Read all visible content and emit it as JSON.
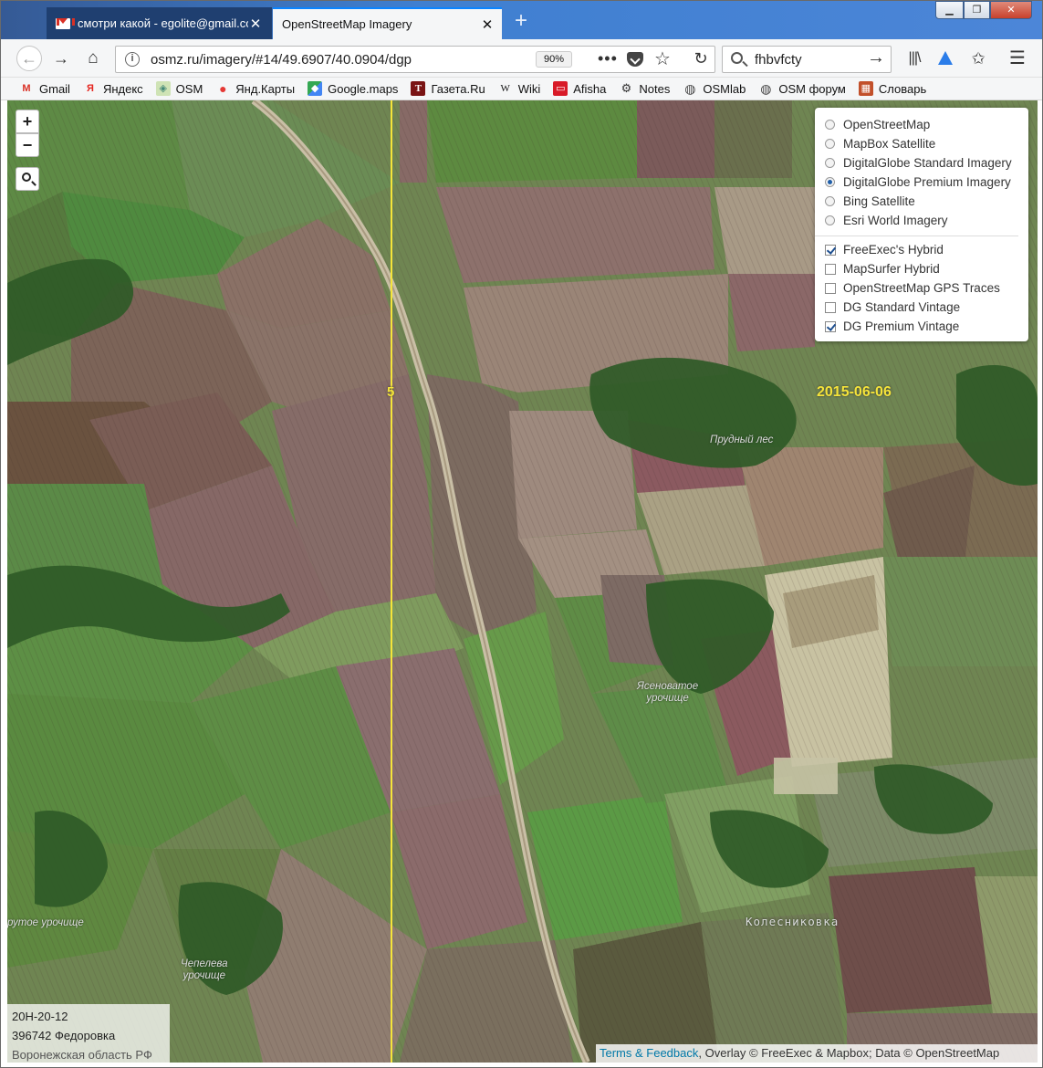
{
  "tabs": [
    {
      "title": "смотри какой - egolite@gmail.com",
      "active": false,
      "favicon": "gmail-icon"
    },
    {
      "title": "OpenStreetMap Imagery",
      "active": true
    }
  ],
  "window_controls": {
    "minimize": "▁",
    "maximize": "❐",
    "close": "✕"
  },
  "toolbar": {
    "url": "osmz.ru/imagery/#14/49.6907/40.0904/dgp",
    "zoom": "90%",
    "search_value": "fhbvfcty"
  },
  "bookmarks": [
    {
      "label": "Gmail",
      "icon": "gmail-icon"
    },
    {
      "label": "Яндекс",
      "icon": "yandex-icon"
    },
    {
      "label": "OSM",
      "icon": "osm-icon"
    },
    {
      "label": "Янд.Карты",
      "icon": "map-pin-icon"
    },
    {
      "label": "Google.maps",
      "icon": "google-maps-icon"
    },
    {
      "label": "Газета.Ru",
      "icon": "gazeta-icon"
    },
    {
      "label": "Wiki",
      "icon": "wiki-icon"
    },
    {
      "label": "Afisha",
      "icon": "afisha-icon"
    },
    {
      "label": "Notes",
      "icon": "notes-icon"
    },
    {
      "label": "OSMlab",
      "icon": "globe-icon"
    },
    {
      "label": "OSM форум",
      "icon": "globe-icon"
    },
    {
      "label": "Словарь",
      "icon": "dictionary-icon"
    }
  ],
  "map": {
    "zoom_in": "+",
    "zoom_out": "−",
    "base_layers": [
      {
        "label": "OpenStreetMap",
        "selected": false
      },
      {
        "label": "MapBox Satellite",
        "selected": false
      },
      {
        "label": "DigitalGlobe Standard Imagery",
        "selected": false
      },
      {
        "label": "DigitalGlobe Premium Imagery",
        "selected": true
      },
      {
        "label": "Bing Satellite",
        "selected": false
      },
      {
        "label": "Esri World Imagery",
        "selected": false
      }
    ],
    "overlays": [
      {
        "label": "FreeExec's Hybrid",
        "checked": true
      },
      {
        "label": "MapSurfer Hybrid",
        "checked": false
      },
      {
        "label": "OpenStreetMap GPS Traces",
        "checked": false
      },
      {
        "label": "DG Standard Vintage",
        "checked": false
      },
      {
        "label": "DG Premium Vintage",
        "checked": true
      }
    ],
    "imagery_date": "2015-06-06",
    "grid_number": "5",
    "places": {
      "forest": "Прудный лес",
      "yasenovatoe_1": "Ясеноватое",
      "yasenovatoe_2": "урочище",
      "krutoe": "рутое урочище",
      "chepeleva_1": "Чепелева",
      "chepeleva_2": "урочище",
      "kolesnikovka": "Колесниковка"
    },
    "info_box": {
      "line1": "20Н-20-12",
      "line2": "396742 Федоровка",
      "line3": "Воронежская область РФ"
    },
    "attribution": {
      "link": "Terms & Feedback",
      "text": ", Overlay © FreeExec & Mapbox; Data © OpenStreetMap"
    }
  },
  "colors": {
    "tab_accent": "#0a84ff",
    "grid_line": "#f5e43a",
    "link": "#0078a8"
  }
}
